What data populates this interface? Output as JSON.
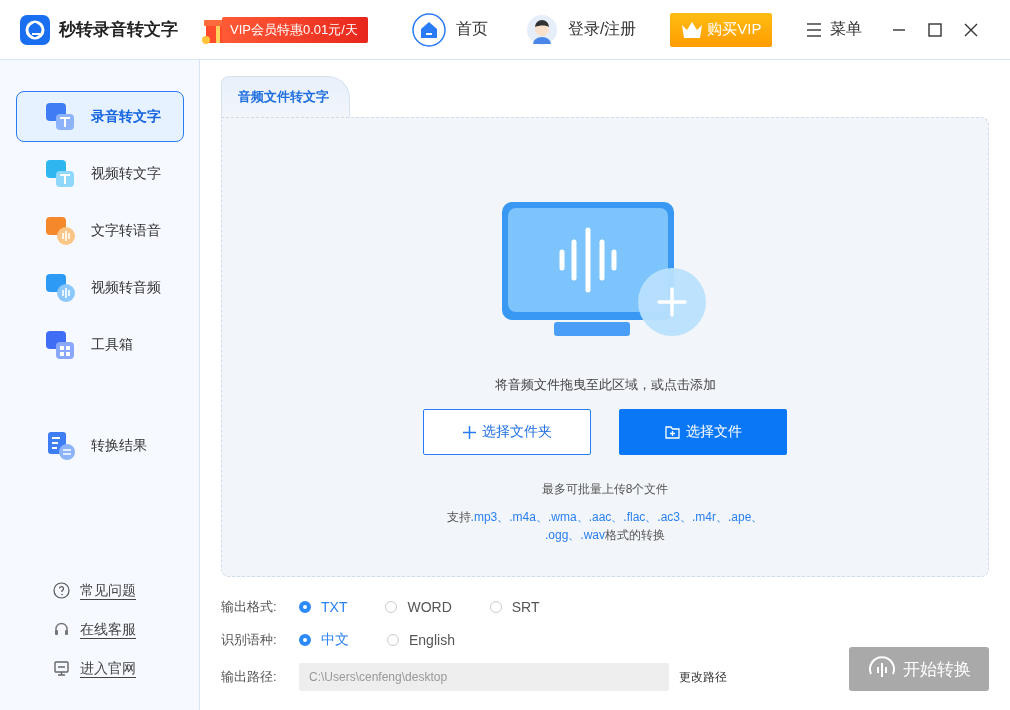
{
  "header": {
    "app_title": "秒转录音转文字",
    "promo": "VIP会员特惠0.01元/天",
    "home": "首页",
    "login": "登录/注册",
    "vip_button": "购买VIP",
    "menu": "菜单"
  },
  "sidebar": {
    "items": [
      {
        "label": "录音转文字",
        "kind": "audio",
        "selected": true
      },
      {
        "label": "视频转文字",
        "kind": "video",
        "selected": false
      },
      {
        "label": "文字转语音",
        "kind": "tts",
        "selected": false
      },
      {
        "label": "视频转音频",
        "kind": "video-audio",
        "selected": false
      },
      {
        "label": "工具箱",
        "kind": "toolbox",
        "selected": false
      }
    ],
    "results": "转换结果",
    "links": [
      {
        "label": "常见问题",
        "kind": "help"
      },
      {
        "label": "在线客服",
        "kind": "support"
      },
      {
        "label": "进入官网",
        "kind": "website"
      }
    ]
  },
  "tab": {
    "label": "音频文件转文字",
    "selected": true
  },
  "drop_area": {
    "hint": "将音频文件拖曳至此区域，或点击添加",
    "folder_button": "选择文件夹",
    "file_button": "选择文件",
    "limit": "最多可批量上传8个文件",
    "support_prefix": "支持",
    "formats": [
      ".mp3、",
      ".m4a、",
      ".wma、",
      ".aac、",
      ".flac、",
      ".ac3、",
      ".m4r、",
      ".ape、",
      ".ogg、",
      ".wav"
    ],
    "support_suffix": "格式的转换"
  },
  "output_format": {
    "label": "输出格式:",
    "options": [
      {
        "label": "TXT",
        "selected": true
      },
      {
        "label": "WORD",
        "selected": false
      },
      {
        "label": "SRT",
        "selected": false
      }
    ]
  },
  "language": {
    "label": "识别语种:",
    "options": [
      {
        "label": "中文",
        "selected": true
      },
      {
        "label": "English",
        "selected": false
      }
    ]
  },
  "output_path": {
    "label": "输出路径:",
    "value": "C:\\Users\\cenfeng\\desktop",
    "change": "更改路径"
  },
  "start_button": {
    "label": "开始转换",
    "disabled": true
  }
}
